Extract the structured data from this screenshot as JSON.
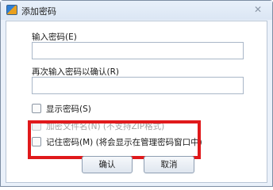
{
  "window": {
    "title": "添加密码",
    "close_glyph": "✕"
  },
  "fields": {
    "password_label": "输入密码(E)",
    "password_value": "",
    "confirm_label": "再次输入密码以确认(R)",
    "confirm_value": ""
  },
  "options": {
    "show_password": "显示密码(S)",
    "encrypt_filename": "加密文件名(N) (不支持ZIP格式)",
    "remember_password": "记住密码(M) (将会显示在管理密码窗口中)"
  },
  "buttons": {
    "ok": "确认",
    "cancel": "取消"
  },
  "colors": {
    "highlight": "#e0191b",
    "background": "#eaf1fa"
  }
}
